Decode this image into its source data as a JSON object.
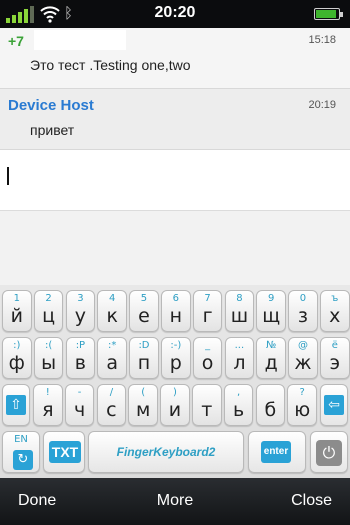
{
  "status_bar": {
    "time": "20:20",
    "battery_level": 0.9,
    "colors": {
      "signal": "#8bd63a",
      "battery": "#3fb52e"
    }
  },
  "messages": [
    {
      "sender": "+7",
      "time": "15:18",
      "text": "Это тест .Testing one,two",
      "sender_color": "#3ba238"
    },
    {
      "sender": "Device Host",
      "time": "20:19",
      "text": "привет",
      "sender_color": "#2a7bd2"
    }
  ],
  "compose": {
    "value": ""
  },
  "keyboard": {
    "rows": [
      [
        {
          "top": "1",
          "main": "й"
        },
        {
          "top": "2",
          "main": "ц"
        },
        {
          "top": "3",
          "main": "у"
        },
        {
          "top": "4",
          "main": "к"
        },
        {
          "top": "5",
          "main": "е"
        },
        {
          "top": "6",
          "main": "н"
        },
        {
          "top": "7",
          "main": "г"
        },
        {
          "top": "8",
          "main": "ш"
        },
        {
          "top": "9",
          "main": "щ"
        },
        {
          "top": "0",
          "main": "з"
        },
        {
          "top": "ъ",
          "main": "х"
        }
      ],
      [
        {
          "top": ":)",
          "main": "ф"
        },
        {
          "top": ":(",
          "main": "ы"
        },
        {
          "top": ":P",
          "main": "в"
        },
        {
          "top": ":*",
          "main": "а"
        },
        {
          "top": ":D",
          "main": "п"
        },
        {
          "top": ":-)",
          "main": "р"
        },
        {
          "top": "_",
          "main": "о"
        },
        {
          "top": "...",
          "main": "л"
        },
        {
          "top": "№",
          "main": "д"
        },
        {
          "top": "@",
          "main": "ж"
        },
        {
          "top": "ё",
          "main": "э"
        }
      ],
      [
        {
          "top": "!",
          "main": "я"
        },
        {
          "top": "-",
          "main": "ч"
        },
        {
          "top": "/",
          "main": "с"
        },
        {
          "top": "(",
          "main": "м"
        },
        {
          "top": ")",
          "main": "и"
        },
        {
          "top": "",
          "main": "т"
        },
        {
          "top": ",",
          "main": "ь"
        },
        {
          "top": "",
          "main": "б"
        },
        {
          "top": "?",
          "main": "ю"
        }
      ]
    ],
    "labels": {
      "lang": "EN",
      "txt": "TXT",
      "space": "FingerKeyboard2",
      "enter": "enter"
    },
    "accent": "#2aa2d6"
  },
  "softkeys": {
    "left": "Done",
    "middle": "More",
    "right": "Close"
  }
}
